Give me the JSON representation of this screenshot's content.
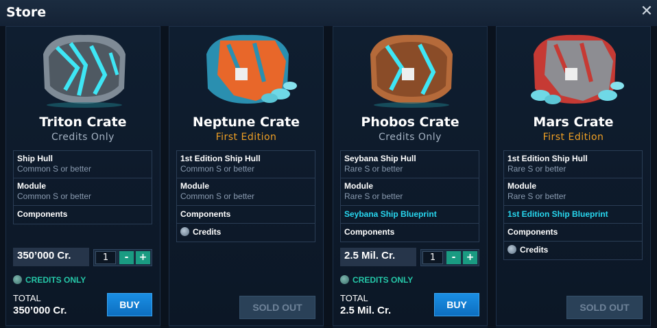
{
  "window": {
    "title": "Store"
  },
  "cards": [
    {
      "name": "Triton Crate",
      "subtitle": "Credits Only",
      "rows": [
        {
          "title": "Ship Hull",
          "detail": "Common S or better"
        },
        {
          "title": "Module",
          "detail": "Common S or better"
        },
        {
          "title": "Components"
        }
      ],
      "price": "350’000 Cr.",
      "quantity": "1",
      "credits_only": "CREDITS ONLY",
      "total_label": "TOTAL",
      "total_value": "350’000 Cr.",
      "buy": "BUY"
    },
    {
      "name": "Neptune Crate",
      "subtitle": "First Edition",
      "rows": [
        {
          "title": "1st Edition Ship Hull",
          "detail": "Common S or better"
        },
        {
          "title": "Module",
          "detail": "Common S or better"
        },
        {
          "title": "Components"
        },
        {
          "title": "Credits"
        }
      ],
      "sold_out": "SOLD OUT"
    },
    {
      "name": "Phobos Crate",
      "subtitle": "Credits Only",
      "rows": [
        {
          "title": "Seybana Ship Hull",
          "detail": "Rare S or better"
        },
        {
          "title": "Module",
          "detail": "Rare S or better"
        },
        {
          "title": "Seybana Ship Blueprint"
        },
        {
          "title": "Components"
        }
      ],
      "price": "2.5 Mil. Cr.",
      "quantity": "1",
      "credits_only": "CREDITS ONLY",
      "total_label": "TOTAL",
      "total_value": "2.5 Mil. Cr.",
      "buy": "BUY"
    },
    {
      "name": "Mars Crate",
      "subtitle": "First Edition",
      "rows": [
        {
          "title": "1st Edition Ship Hull",
          "detail": "Rare S or better"
        },
        {
          "title": "Module",
          "detail": "Rare S or better"
        },
        {
          "title": "1st Edition Ship Blueprint"
        },
        {
          "title": "Components"
        },
        {
          "title": "Credits"
        }
      ],
      "sold_out": "SOLD OUT"
    }
  ],
  "qty_controls": {
    "minus": "-",
    "plus": "+"
  },
  "colors": {
    "accent_cyan": "#28d8f0",
    "first_edition": "#f0a024",
    "credits_green": "#25c7a8",
    "buy_blue": "#1a8fe4"
  },
  "icons": [
    "close-icon",
    "credits-icon"
  ]
}
